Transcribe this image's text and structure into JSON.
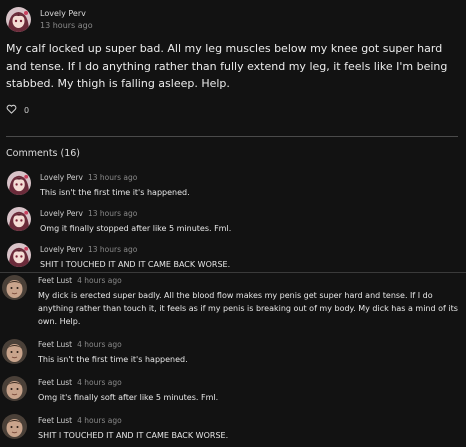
{
  "post": {
    "author": "Lovely Perv",
    "time": "13 hours ago",
    "text": "My calf locked up super bad. All my leg muscles below my knee got super hard and tense. If I do anything rather than fully extend my leg, it feels like I'm being stabbed. My thigh is falling asleep. Help.",
    "like_count": "0",
    "like_icon": "heart-outline-icon"
  },
  "comments_header": "Comments (16)",
  "replies": [
    {
      "author": "Lovely Perv",
      "time": "13 hours ago",
      "text": "This isn't the first time it's happened."
    },
    {
      "author": "Lovely Perv",
      "time": "13 hours ago",
      "text": "Omg it finally stopped after like 5 minutes. Fml."
    },
    {
      "author": "Lovely Perv",
      "time": "13 hours ago",
      "text": "SHIT I TOUCHED IT AND IT CAME BACK WORSE."
    }
  ],
  "comments": [
    {
      "author": "Feet Lust",
      "time": "4 hours ago",
      "text": "My dick is erected super badly. All the blood flow makes my penis get super hard and tense. If I do anything rather than touch it, it feels as if my penis is breaking out of my body. My dick has a mind of its own. Help."
    },
    {
      "author": "Feet Lust",
      "time": "4 hours ago",
      "text": "This isn't the first time it's happened."
    },
    {
      "author": "Feet Lust",
      "time": "4 hours ago",
      "text": "Omg it's finally soft after like 5 minutes. Fml."
    },
    {
      "author": "Feet Lust",
      "time": "4 hours ago",
      "text": "SHIT I TOUCHED IT AND IT CAME BACK WORSE."
    }
  ],
  "colors": {
    "background": "#121212",
    "divider": "#4a4a4a",
    "text": "#e6e6e6",
    "muted": "#8a8a8a"
  }
}
